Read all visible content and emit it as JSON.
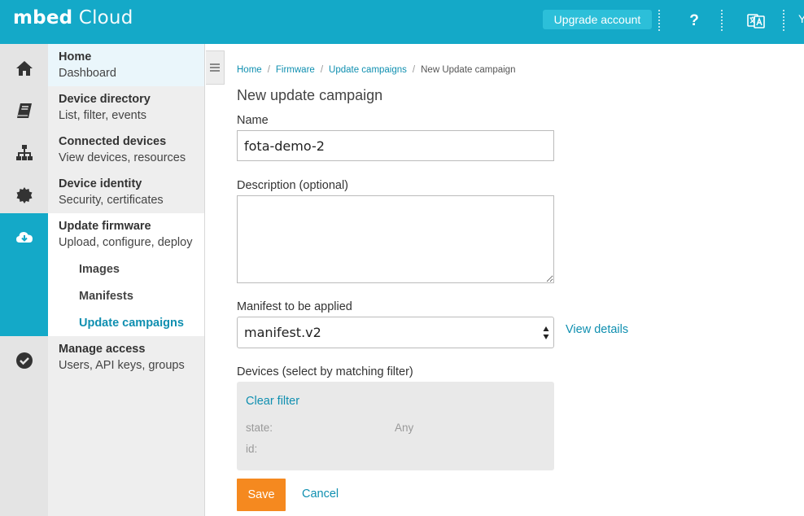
{
  "header": {
    "brand_bold": "mbed",
    "brand_light": " Cloud",
    "upgrade_label": "Upgrade account",
    "help_label": "?",
    "user_initial": "Y",
    "help_icon": "question-mark-icon",
    "language_icon": "translate-icon",
    "bar_color": "#14a9c8"
  },
  "sidebar": {
    "items": [
      {
        "title": "Home",
        "subtitle": "Dashboard",
        "icon": "home-icon"
      },
      {
        "title": "Device directory",
        "subtitle": "List, filter, events",
        "icon": "book-icon"
      },
      {
        "title": "Connected devices",
        "subtitle": "View devices, resources",
        "icon": "sitemap-icon"
      },
      {
        "title": "Device identity",
        "subtitle": "Security, certificates",
        "icon": "badge-icon"
      },
      {
        "title": "Update firmware",
        "subtitle": "Upload, configure, deploy",
        "icon": "cloud-download-icon"
      },
      {
        "title": "Manage access",
        "subtitle": "Users, API keys, groups",
        "icon": "check-circle-icon"
      }
    ],
    "subitems": [
      "Images",
      "Manifests",
      "Update campaigns"
    ],
    "active_item": "Update firmware",
    "active_subitem": "Update campaigns",
    "collapse_icon": "hamburger-icon"
  },
  "breadcrumb": {
    "items": [
      "Home",
      "Firmware",
      "Update campaigns"
    ],
    "current": "New Update campaign",
    "separator": "/"
  },
  "form": {
    "title": "New update campaign",
    "name_label": "Name",
    "name_value": "fota-demo-2",
    "description_label": "Description (optional)",
    "description_value": "",
    "manifest_label": "Manifest to be applied",
    "manifest_value": "manifest.v2",
    "view_details_label": "View details",
    "devices_label": "Devices (select by matching filter)",
    "clear_filter_label": "Clear filter",
    "filters": [
      {
        "key": "state:",
        "value": "Any"
      },
      {
        "key": "id:",
        "value": ""
      }
    ],
    "save_label": "Save",
    "cancel_label": "Cancel"
  },
  "colors": {
    "accent": "#14a9c8",
    "link": "#0f8fb0",
    "save_button": "#f5891f"
  }
}
